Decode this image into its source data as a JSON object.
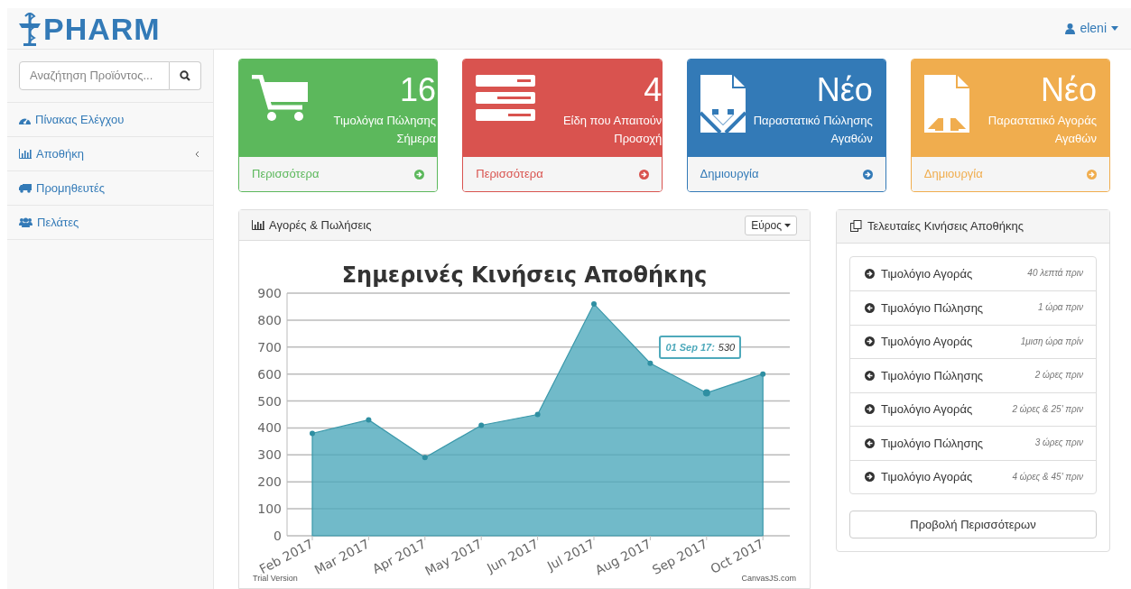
{
  "brand": "PHARM",
  "user": {
    "name": "eleni"
  },
  "search": {
    "placeholder": "Αναζήτηση Προϊόντος..."
  },
  "sidebar": {
    "items": [
      {
        "label": "Πίνακας Ελέγχου"
      },
      {
        "label": "Αποθήκη",
        "collapsible": true
      },
      {
        "label": "Προμηθευτές"
      },
      {
        "label": "Πελάτες"
      }
    ]
  },
  "cards": [
    {
      "value": "16",
      "label": "Τιμολόγια Πώλησης Σήμερα",
      "link": "Περισσότερα",
      "color": "#5cb85c"
    },
    {
      "value": "4",
      "label": "Είδη που Απαιτούν Προσοχή",
      "link": "Περισσότερα",
      "color": "#d9534f"
    },
    {
      "value": "Νέο",
      "label": "Παραστατικό Πώλησης Αγαθών",
      "link": "Δημιουργία",
      "color": "#337ab7"
    },
    {
      "value": "Νέο",
      "label": "Παραστατικό Αγοράς Αγαθών",
      "link": "Δημιουργία",
      "color": "#f0ad4e"
    }
  ],
  "chart_panel": {
    "title": "Αγορές & Πωλήσεις",
    "dropdown": "Εύρος",
    "chart_data": {
      "type": "area",
      "title": "Σημερινές Κινήσεις Αποθήκης",
      "categories": [
        "Feb 2017",
        "Mar 2017",
        "Apr 2017",
        "May 2017",
        "Jun 2017",
        "Jul 2017",
        "Aug 2017",
        "Sep 2017",
        "Oct 2017"
      ],
      "series": [
        {
          "color": "#4ea9bb",
          "values": [
            380,
            430,
            290,
            410,
            450,
            860,
            640,
            530,
            600
          ]
        }
      ],
      "ylim": [
        0,
        900
      ],
      "yticks": [
        0,
        100,
        200,
        300,
        400,
        500,
        600,
        700,
        800,
        900
      ],
      "grid": true
    },
    "tooltip": {
      "label": "01 Sep 17:",
      "value": "530"
    },
    "footer_left": "Trial Version",
    "footer_right": "CanvasJS.com"
  },
  "movements": {
    "title": "Τελευταίες Κινήσεις Αποθήκης",
    "items": [
      {
        "label": "Τιμολόγιο Αγοράς",
        "time": "40 λεπτά πριν",
        "kind": "in"
      },
      {
        "label": "Τιμολόγιο Πώλησης",
        "time": "1 ώρα πριν",
        "kind": "out"
      },
      {
        "label": "Τιμολόγιο Αγοράς",
        "time": "1μιση ώρα πρίν",
        "kind": "in"
      },
      {
        "label": "Τιμολόγιο Πώλησης",
        "time": "2 ώρες πριν",
        "kind": "out"
      },
      {
        "label": "Τιμολόγιο Αγοράς",
        "time": "2 ώρες & 25' πριν",
        "kind": "in"
      },
      {
        "label": "Τιμολόγιο Πώλησης",
        "time": "3 ώρες πριν",
        "kind": "out"
      },
      {
        "label": "Τιμολόγιο Αγοράς",
        "time": "4 ώρες & 45' πριν",
        "kind": "in"
      }
    ],
    "button": "Προβολή Περισσότερων"
  }
}
